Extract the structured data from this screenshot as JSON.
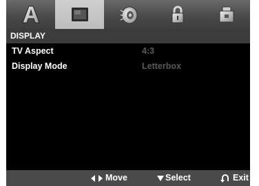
{
  "tabs": [
    {
      "icon": "language-a-icon",
      "active": false
    },
    {
      "icon": "display-screen-icon",
      "active": true
    },
    {
      "icon": "audio-speaker-icon",
      "active": false
    },
    {
      "icon": "lock-icon",
      "active": false
    },
    {
      "icon": "others-settings-icon",
      "active": false
    }
  ],
  "section": {
    "title": "DISPLAY"
  },
  "settings": [
    {
      "label": "TV Aspect",
      "value": "4:3"
    },
    {
      "label": "Display Mode",
      "value": "Letterbox"
    }
  ],
  "footer": {
    "move_label": "Move",
    "select_label": "Select",
    "exit_label": "Exit"
  },
  "colors": {
    "background": "#000000",
    "active_tab": "#c6c6c6",
    "header_bar": "#3c3c3c",
    "value_text": "#5a5a5a",
    "footer_bar": "#4a4a4a"
  }
}
